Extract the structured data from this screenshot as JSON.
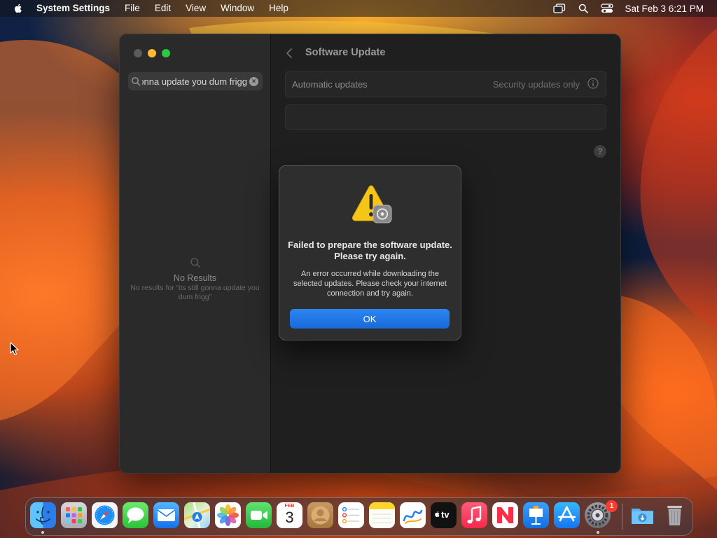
{
  "menubar": {
    "app_name": "System Settings",
    "menus": [
      "File",
      "Edit",
      "View",
      "Window",
      "Help"
    ],
    "clock": "Sat Feb 3  6:21 PM",
    "status_icons": [
      "screen-mirroring-icon",
      "spotlight-search-icon",
      "control-center-icon"
    ]
  },
  "sidebar": {
    "search": {
      "value": "its still gonna update you dum frigg",
      "visible_text": "na update you dum frigg",
      "placeholder": "Search"
    },
    "no_results": {
      "title": "No Results",
      "detail": "No results for “its still gonna update you dum frigg”"
    }
  },
  "content": {
    "title": "Software Update",
    "automatic_updates": {
      "label": "Automatic updates",
      "value": "Security updates only"
    },
    "help_glyph": "?"
  },
  "dialog": {
    "title": "Failed to prepare the software update. Please try again.",
    "message": "An error occurred while downloading the selected updates. Please check your internet connection and try again.",
    "ok_label": "OK"
  },
  "dock": {
    "apps": [
      {
        "name": "Finder",
        "icon": "finder-icon",
        "running": true
      },
      {
        "name": "Launchpad",
        "icon": "launchpad-icon",
        "running": false
      },
      {
        "name": "Safari",
        "icon": "safari-icon",
        "running": false
      },
      {
        "name": "Messages",
        "icon": "messages-icon",
        "running": false
      },
      {
        "name": "Mail",
        "icon": "mail-icon",
        "running": false
      },
      {
        "name": "Maps",
        "icon": "maps-icon",
        "running": false
      },
      {
        "name": "Photos",
        "icon": "photos-icon",
        "running": false
      },
      {
        "name": "FaceTime",
        "icon": "facetime-icon",
        "running": false
      },
      {
        "name": "Calendar",
        "icon": "calendar-icon",
        "running": false,
        "month": "FEB",
        "day": "3"
      },
      {
        "name": "Contacts",
        "icon": "contacts-icon",
        "running": false
      },
      {
        "name": "Reminders",
        "icon": "reminders-icon",
        "running": false
      },
      {
        "name": "Notes",
        "icon": "notes-icon",
        "running": false
      },
      {
        "name": "Freeform",
        "icon": "freeform-icon",
        "running": false
      },
      {
        "name": "TV",
        "icon": "tv-icon",
        "running": false,
        "label": "tv"
      },
      {
        "name": "Music",
        "icon": "music-icon",
        "running": false
      },
      {
        "name": "News",
        "icon": "news-icon",
        "running": false
      },
      {
        "name": "Keynote",
        "icon": "keynote-icon",
        "running": false
      },
      {
        "name": "App Store",
        "icon": "app-store-icon",
        "running": false
      },
      {
        "name": "System Settings",
        "icon": "system-settings-icon",
        "running": true,
        "badge": "1"
      }
    ],
    "downloads": {
      "name": "Downloads",
      "icon": "downloads-folder-icon"
    },
    "trash": {
      "name": "Trash",
      "icon": "trash-icon"
    }
  },
  "colors": {
    "accent": "#1a73e8",
    "window_bg": "#1f1f1f",
    "sidebar_bg": "#2a2a2a",
    "warning_yellow": "#f5c518",
    "badge_red": "#ff3b30"
  }
}
